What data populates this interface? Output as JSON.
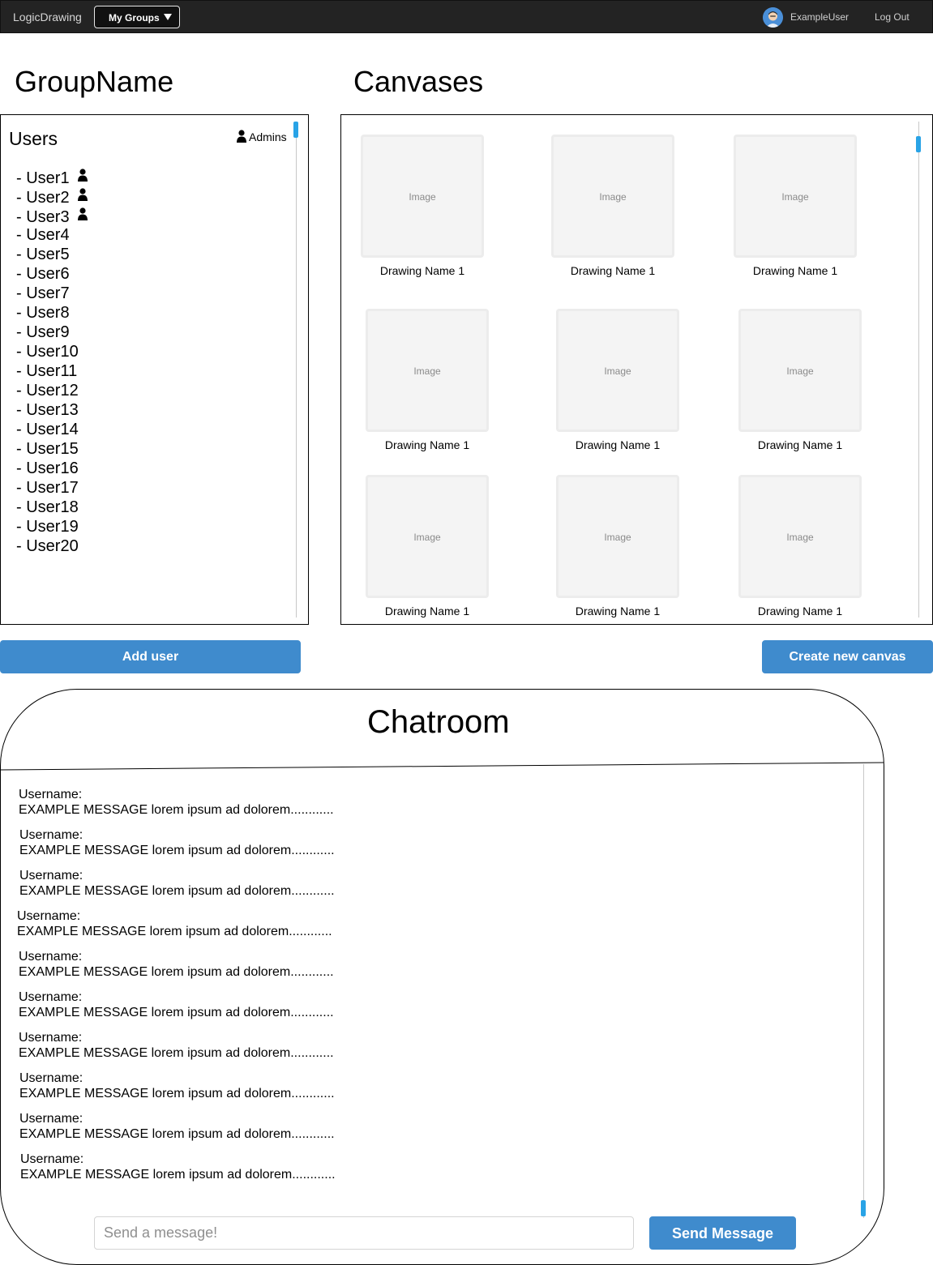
{
  "topbar": {
    "brand": "LogicDrawing",
    "groups_label": "My Groups",
    "username": "ExampleUser",
    "logout_label": "Log Out"
  },
  "group": {
    "name": "GroupName",
    "users_title": "Users",
    "admins_label": "Admins",
    "users": [
      {
        "label": "- User1",
        "admin": true
      },
      {
        "label": "- User2",
        "admin": true
      },
      {
        "label": "- User3",
        "admin": true
      },
      {
        "label": "- User4",
        "admin": false
      },
      {
        "label": "- User5",
        "admin": false
      },
      {
        "label": "- User6",
        "admin": false
      },
      {
        "label": "- User7",
        "admin": false
      },
      {
        "label": "- User8",
        "admin": false
      },
      {
        "label": "- User9",
        "admin": false
      },
      {
        "label": "- User10",
        "admin": false
      },
      {
        "label": "- User11",
        "admin": false
      },
      {
        "label": "- User12",
        "admin": false
      },
      {
        "label": "- User13",
        "admin": false
      },
      {
        "label": "- User14",
        "admin": false
      },
      {
        "label": "- User15",
        "admin": false
      },
      {
        "label": "- User16",
        "admin": false
      },
      {
        "label": "- User17",
        "admin": false
      },
      {
        "label": "- User18",
        "admin": false
      },
      {
        "label": "- User19",
        "admin": false
      },
      {
        "label": "- User20",
        "admin": false
      }
    ],
    "add_user_label": "Add user"
  },
  "canvases": {
    "title": "Canvases",
    "items": [
      {
        "image_label": "Image",
        "name": "Drawing Name 1"
      },
      {
        "image_label": "Image",
        "name": "Drawing Name 1"
      },
      {
        "image_label": "Image",
        "name": "Drawing Name 1"
      },
      {
        "image_label": "Image",
        "name": "Drawing Name 1"
      },
      {
        "image_label": "Image",
        "name": "Drawing Name 1"
      },
      {
        "image_label": "Image",
        "name": "Drawing Name 1"
      },
      {
        "image_label": "Image",
        "name": "Drawing Name 1"
      },
      {
        "image_label": "Image",
        "name": "Drawing Name 1"
      },
      {
        "image_label": "Image",
        "name": "Drawing Name 1"
      }
    ],
    "create_label": "Create new canvas"
  },
  "chatroom": {
    "title": "Chatroom",
    "messages": [
      {
        "username": "Username:",
        "text": "EXAMPLE MESSAGE lorem ipsum ad dolorem............"
      },
      {
        "username": "Username:",
        "text": "EXAMPLE MESSAGE lorem ipsum ad dolorem............"
      },
      {
        "username": "Username:",
        "text": "EXAMPLE MESSAGE lorem ipsum ad dolorem............"
      },
      {
        "username": "Username:",
        "text": "EXAMPLE MESSAGE lorem ipsum ad dolorem............"
      },
      {
        "username": "Username:",
        "text": "EXAMPLE MESSAGE lorem ipsum ad dolorem............"
      },
      {
        "username": "Username:",
        "text": "EXAMPLE MESSAGE lorem ipsum ad dolorem............"
      },
      {
        "username": "Username:",
        "text": "EXAMPLE MESSAGE lorem ipsum ad dolorem............"
      },
      {
        "username": "Username:",
        "text": "EXAMPLE MESSAGE lorem ipsum ad dolorem............"
      },
      {
        "username": "Username:",
        "text": "EXAMPLE MESSAGE lorem ipsum ad dolorem............"
      },
      {
        "username": "Username:",
        "text": "EXAMPLE MESSAGE lorem ipsum ad dolorem............"
      }
    ],
    "input_value": "",
    "input_placeholder": "Send a message!",
    "send_label": "Send Message"
  },
  "icons": {
    "avatar": "user-avatar-icon",
    "admin": "person-icon",
    "dropdown": "caret-down-icon"
  },
  "colors": {
    "topbar_bg": "#232323",
    "accent": "#3f8bcd",
    "scroll_thumb": "#29a3e6"
  }
}
